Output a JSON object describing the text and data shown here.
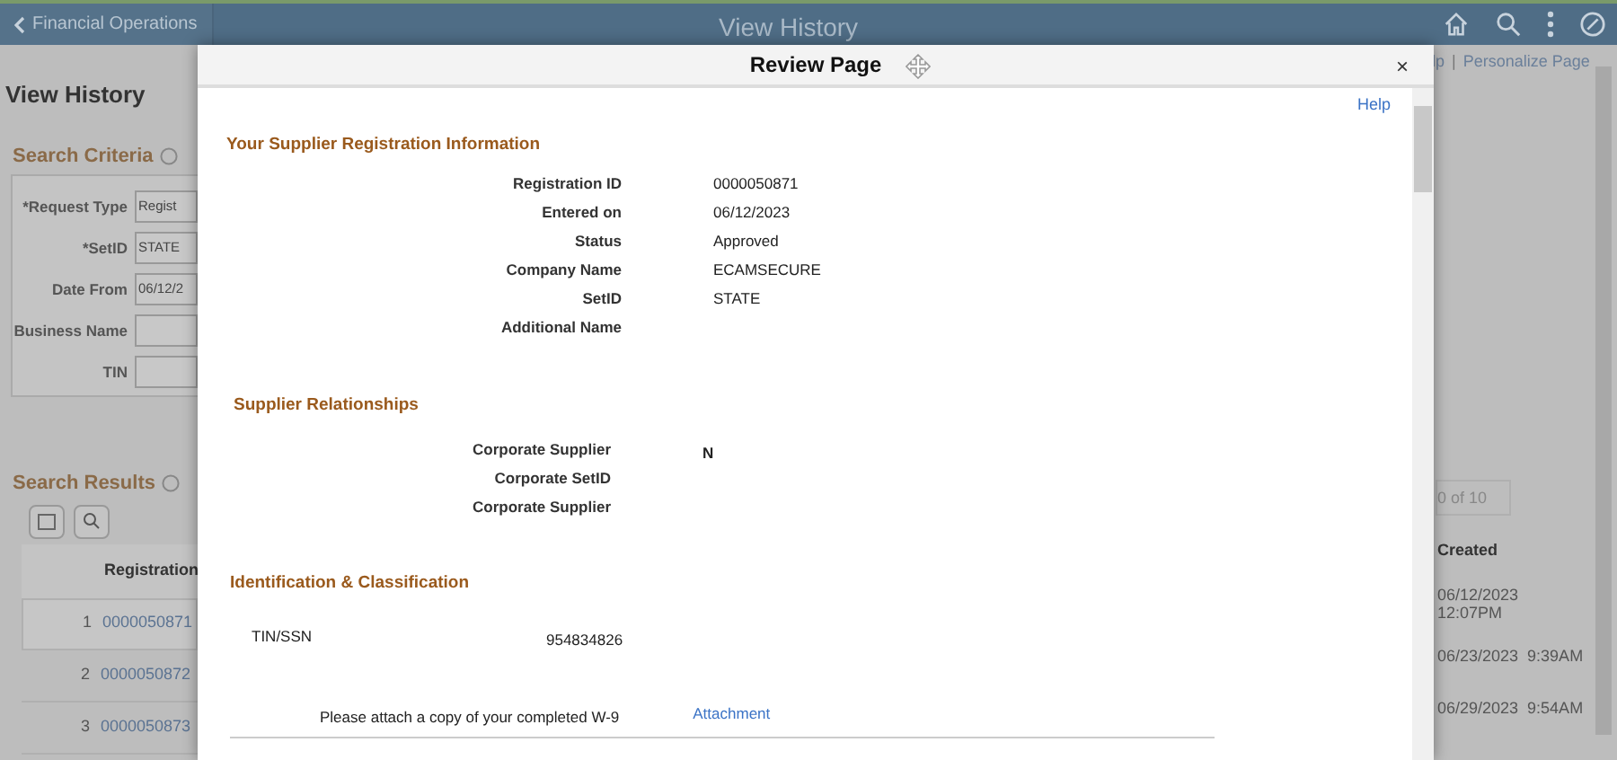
{
  "header": {
    "back_label": "Financial Operations",
    "title": "View History"
  },
  "background": {
    "page_title": "View History",
    "criteria_title": "Search Criteria",
    "criteria_fields": [
      {
        "label": "*Request Type",
        "value": "Regist"
      },
      {
        "label": "*SetID",
        "value": "STATE"
      },
      {
        "label": "Date From",
        "value": "06/12/2"
      },
      {
        "label": "Business Name"
      },
      {
        "label": "TIN"
      }
    ],
    "results_title": "Search Results",
    "column_1": "Registration",
    "pager": "0 of 10",
    "column_2": "Created",
    "rows": [
      {
        "number": "1",
        "id": "0000050871",
        "created": "06/12/2023 12:07PM",
        "selected": true
      },
      {
        "number": "2",
        "id": "0000050872",
        "created": "06/23/2023  9:39AM",
        "selected": false
      },
      {
        "number": "3",
        "id": "0000050873",
        "created": "06/29/2023  9:54AM",
        "selected": false
      }
    ],
    "top_links": [
      "lp",
      "Personalize Page"
    ],
    "top_links_separator": "|"
  },
  "modal": {
    "title": "Review Page",
    "close_label": "×",
    "help_link": "Help",
    "sections": [
      {
        "heading": "Your Supplier Registration Information",
        "kind": "fields",
        "fields": [
          {
            "label": "Registration ID",
            "value": "0000050871"
          },
          {
            "label": "Entered on",
            "value": "06/12/2023"
          },
          {
            "label": "Status",
            "value": "Approved"
          },
          {
            "label": "Company Name",
            "value": "ECAMSECURE"
          },
          {
            "label": "SetID",
            "value": "STATE"
          },
          {
            "label": "Additional Name"
          }
        ]
      },
      {
        "heading": "Supplier Relationships",
        "kind": "relations",
        "fields": [
          {
            "label": "Corporate Supplier",
            "value": "N"
          },
          {
            "label": "Corporate SetID"
          },
          {
            "label": "Corporate Supplier"
          }
        ]
      },
      {
        "heading": "Identification & Classification",
        "kind": "ident",
        "fields": [
          {
            "label": "TIN/SSN",
            "value": "954834826"
          }
        ],
        "attach_text": "Please attach a copy of your completed W-9",
        "attach_link": "Attachment"
      }
    ]
  }
}
